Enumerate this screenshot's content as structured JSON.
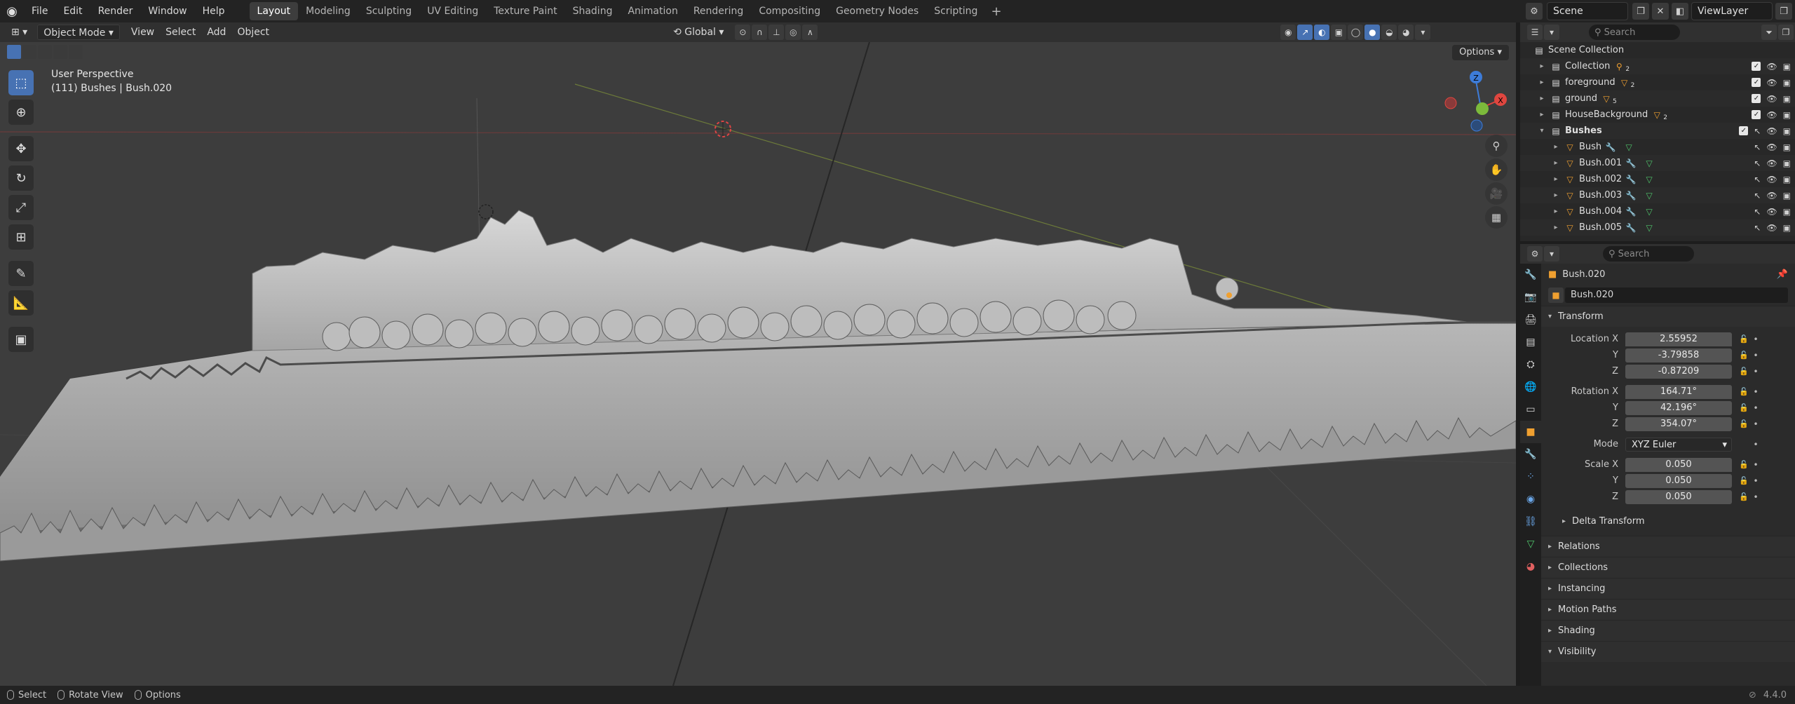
{
  "topbar": {
    "menus": [
      "File",
      "Edit",
      "Render",
      "Window",
      "Help"
    ],
    "workspaces": [
      "Layout",
      "Modeling",
      "Sculpting",
      "UV Editing",
      "Texture Paint",
      "Shading",
      "Animation",
      "Rendering",
      "Compositing",
      "Geometry Nodes",
      "Scripting"
    ],
    "active_workspace": "Layout",
    "scene": "Scene",
    "view_layer": "ViewLayer"
  },
  "viewport_header": {
    "mode": "Object Mode",
    "menus": [
      "View",
      "Select",
      "Add",
      "Object"
    ],
    "orientation": "Global"
  },
  "viewport": {
    "perspective_label": "User Perspective",
    "object_label": "(111) Bushes | Bush.020",
    "options_label": "Options",
    "gizmo_axes": [
      "X",
      "Y",
      "Z"
    ]
  },
  "outliner": {
    "search_placeholder": "Search",
    "root": "Scene Collection",
    "rows": [
      {
        "name": "Collection",
        "badge": "2"
      },
      {
        "name": "foreground",
        "badge": "2"
      },
      {
        "name": "ground",
        "badge": "5"
      },
      {
        "name": "HouseBackground",
        "badge": "2"
      },
      {
        "name": "Bushes",
        "badge": ""
      },
      {
        "name": "Bush",
        "badge": ""
      },
      {
        "name": "Bush.001",
        "badge": ""
      },
      {
        "name": "Bush.002",
        "badge": ""
      },
      {
        "name": "Bush.003",
        "badge": ""
      },
      {
        "name": "Bush.004",
        "badge": ""
      },
      {
        "name": "Bush.005",
        "badge": ""
      }
    ]
  },
  "properties": {
    "search_placeholder": "Search",
    "object_name": "Bush.020",
    "datablock_name": "Bush.020",
    "transform_label": "Transform",
    "location_label": "Location X",
    "rotation_label": "Rotation X",
    "scale_label": "Scale X",
    "y_label": "Y",
    "z_label": "Z",
    "location": [
      "2.55952",
      "-3.79858",
      "-0.87209"
    ],
    "rotation": [
      "164.71°",
      "42.196°",
      "354.07°"
    ],
    "mode_label": "Mode",
    "mode_value": "XYZ Euler",
    "scale": [
      "0.050",
      "0.050",
      "0.050"
    ],
    "delta_transform": "Delta Transform",
    "panels": [
      "Relations",
      "Collections",
      "Instancing",
      "Motion Paths",
      "Shading",
      "Visibility"
    ]
  },
  "statusbar": {
    "items": [
      "Select",
      "Rotate View",
      "Options"
    ],
    "version": "4.4.0"
  },
  "colors": {
    "accent": "#4772b3",
    "x_axis": "#e0463f",
    "y_axis": "#7cba3b",
    "z_axis": "#3d7cd9"
  }
}
